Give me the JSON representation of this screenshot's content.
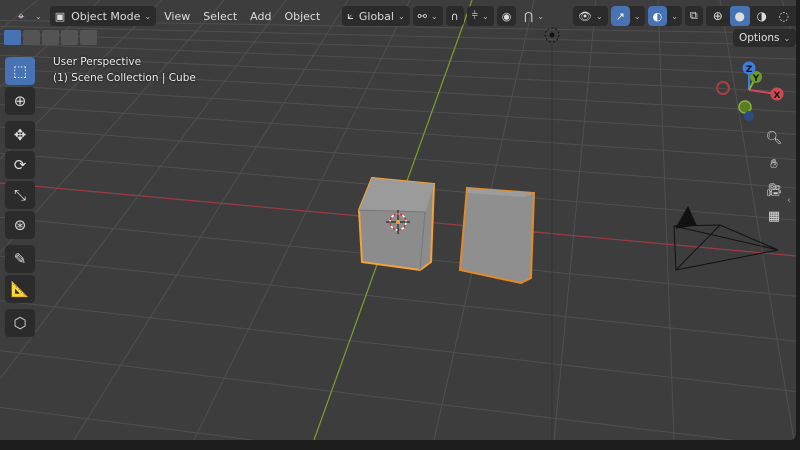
{
  "header": {
    "editor_type_icon": "3d-viewport-icon",
    "mode": "Object Mode",
    "menus": [
      "View",
      "Select",
      "Add",
      "Object"
    ],
    "transform_orientation": "Global"
  },
  "overlay": {
    "view_name": "User Perspective",
    "collection_info": "(1) Scene Collection | Cube"
  },
  "options_label": "Options",
  "gizmo": {
    "z": "Z",
    "y": "Y",
    "x": "X"
  },
  "tools": [
    "select-box",
    "cursor",
    "move",
    "rotate",
    "scale",
    "transform",
    "annotate",
    "measure",
    "add-cube"
  ],
  "colors": {
    "accent": "#4772b3",
    "selection": "#f0a030",
    "x_axis": "#c94a52",
    "y_axis": "#8db03a",
    "viewport": "#3d3d3d"
  }
}
